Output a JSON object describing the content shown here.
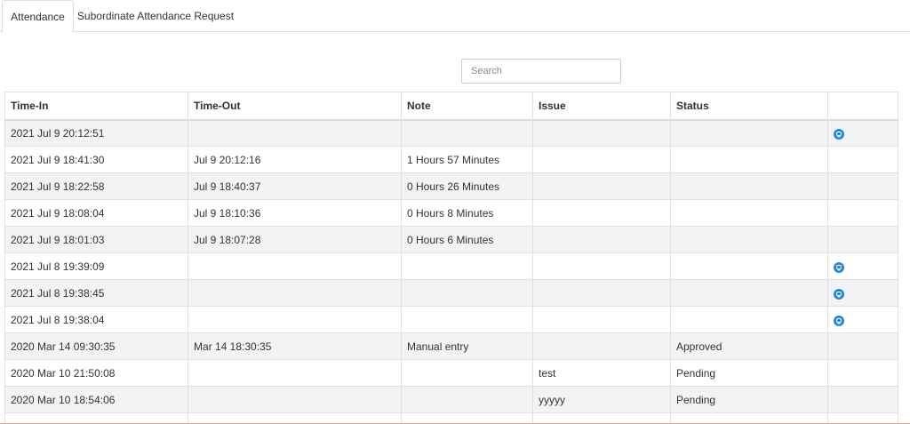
{
  "tabs": [
    {
      "label": "Attendance",
      "active": true
    },
    {
      "label": "Subordinate Attendance Request",
      "active": false
    }
  ],
  "search": {
    "placeholder": "Search",
    "value": ""
  },
  "table": {
    "headers": [
      "Time-In",
      "Time-Out",
      "Note",
      "Issue",
      "Status",
      ""
    ],
    "rows": [
      {
        "time_in": "2021 Jul 9 20:12:51",
        "time_out": "",
        "note": "",
        "issue": "",
        "status": "",
        "icon": "edit-request-icon"
      },
      {
        "time_in": "2021 Jul 9 18:41:30",
        "time_out": "Jul 9 20:12:16",
        "note": "1 Hours 57 Minutes",
        "issue": "",
        "status": "",
        "icon": ""
      },
      {
        "time_in": "2021 Jul 9 18:22:58",
        "time_out": "Jul 9 18:40:37",
        "note": "0 Hours 26 Minutes",
        "issue": "",
        "status": "",
        "icon": ""
      },
      {
        "time_in": "2021 Jul 9 18:08:04",
        "time_out": "Jul 9 18:10:36",
        "note": "0 Hours 8 Minutes",
        "issue": "",
        "status": "",
        "icon": ""
      },
      {
        "time_in": "2021 Jul 9 18:01:03",
        "time_out": "Jul 9 18:07:28",
        "note": "0 Hours 6 Minutes",
        "issue": "",
        "status": "",
        "icon": ""
      },
      {
        "time_in": "2021 Jul 8 19:39:09",
        "time_out": "",
        "note": "",
        "issue": "",
        "status": "",
        "icon": "edit-request-icon"
      },
      {
        "time_in": "2021 Jul 8 19:38:45",
        "time_out": "",
        "note": "",
        "issue": "",
        "status": "",
        "icon": "edit-request-icon"
      },
      {
        "time_in": "2021 Jul 8 19:38:04",
        "time_out": "",
        "note": "",
        "issue": "",
        "status": "",
        "icon": "edit-request-icon"
      },
      {
        "time_in": "2020 Mar 14 09:30:35",
        "time_out": "Mar 14 18:30:35",
        "note": "Manual entry",
        "issue": "",
        "status": "Approved",
        "icon": ""
      },
      {
        "time_in": "2020 Mar 10 21:50:08",
        "time_out": "",
        "note": "",
        "issue": "test",
        "status": "Pending",
        "icon": ""
      },
      {
        "time_in": "2020 Mar 10 18:54:06",
        "time_out": "",
        "note": "",
        "issue": "yyyyy",
        "status": "Pending",
        "icon": ""
      },
      {
        "time_in": "",
        "time_out": "",
        "note": "",
        "issue": "",
        "status": "",
        "icon": ""
      }
    ]
  },
  "colors": {
    "accent_icon": "#1e88e5",
    "row_stripe": "#f2f3f5",
    "border": "#e1e1e1"
  }
}
